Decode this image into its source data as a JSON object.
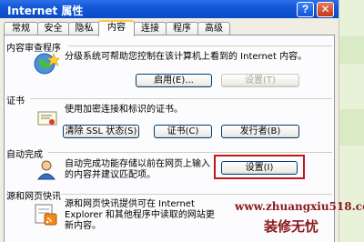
{
  "window": {
    "title": "Internet 属性",
    "help": "?",
    "close": "✕"
  },
  "tabs": [
    "常规",
    "安全",
    "隐私",
    "内容",
    "连接",
    "程序",
    "高级"
  ],
  "content_advisor": {
    "title": "内容审查程序",
    "desc": "分级系统可帮助您控制在该计算机上看到的 Internet 内容。",
    "enable": "启用(E)...",
    "settings": "设置(T)"
  },
  "certificates": {
    "title": "证书",
    "desc": "使用加密连接和标识的证书。",
    "clear_ssl": "清除 SSL 状态(S)",
    "certs": "证书(C)",
    "publishers": "发行者(B)"
  },
  "autocomplete": {
    "title": "自动完成",
    "desc": "自动完成功能存储以前在网页上输入的内容并建议匹配项。",
    "settings": "设置(I)"
  },
  "feeds": {
    "title": "源和网页快讯",
    "desc": "源和网页快讯提供可在 Internet Explorer 和其他程序中读取的网站更新内容。"
  },
  "watermark": {
    "url": "www.zhuangxiu518.com",
    "name": "装修无忧"
  },
  "colors": {
    "title_bar": "#0a4bc8",
    "highlight": "#c01818",
    "tab_accent": "#ffc73c",
    "watermark": "#8a1a1a"
  }
}
